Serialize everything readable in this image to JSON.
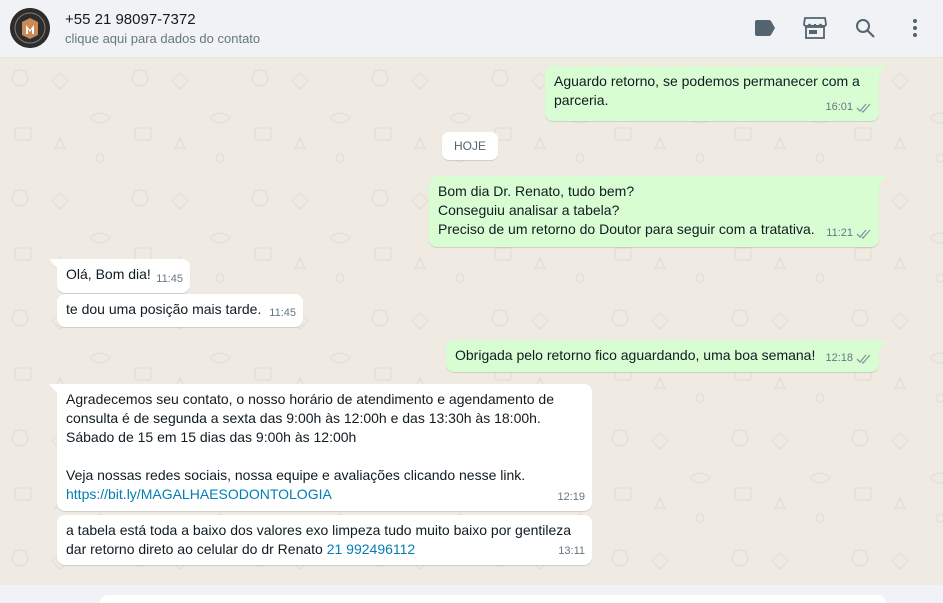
{
  "header": {
    "contact_name": "+55 21 98097-7372",
    "contact_sub": "clique aqui para dados do contato",
    "icons": [
      "label-icon",
      "store-icon",
      "search-icon",
      "menu-icon"
    ]
  },
  "day_separator": "HOJE",
  "messages": [
    {
      "dir": "out",
      "text": "Aguardo retorno, se podemos permanecer com a\nparceria.",
      "time": "16:01",
      "status": "read"
    },
    {
      "dir": "out",
      "text": "Bom dia Dr. Renato, tudo bem?\nConseguiu analisar a tabela?\nPreciso de um retorno do Doutor para seguir com a tratativa.",
      "time": "11:21",
      "status": "read"
    },
    {
      "dir": "in",
      "text": "Olá, Bom dia!",
      "time": "11:45"
    },
    {
      "dir": "in",
      "text": "te dou uma posição mais tarde.",
      "time": "11:45"
    },
    {
      "dir": "out",
      "text": "Obrigada pelo retorno fico aguardando, uma boa semana!",
      "time": "12:18",
      "status": "read"
    },
    {
      "dir": "in",
      "text": "Agradecemos seu contato, o nosso horário de atendimento e agendamento de\nconsulta é de segunda a sexta das 9:00h às 12:00h e das 13:30h às 18:00h.\nSábado de 15 em 15 dias das 9:00h às 12:00h\n\nVeja nossas redes sociais, nossa equipe e avaliações clicando nesse link.",
      "link": "https://bit.ly/MAGALHAESODONTOLOGIA",
      "time": "12:19"
    },
    {
      "dir": "in",
      "text": "a tabela está toda a baixo dos valores exo limpeza tudo muito baixo por gentileza\ndar retorno direto ao celular do dr Renato ",
      "phone": "21 992496112",
      "time": "13:11"
    }
  ],
  "colors": {
    "outgoing": "#d9fdd3",
    "incoming": "#ffffff",
    "read_ticks": "#53bdeb",
    "link": "#027eb5"
  }
}
